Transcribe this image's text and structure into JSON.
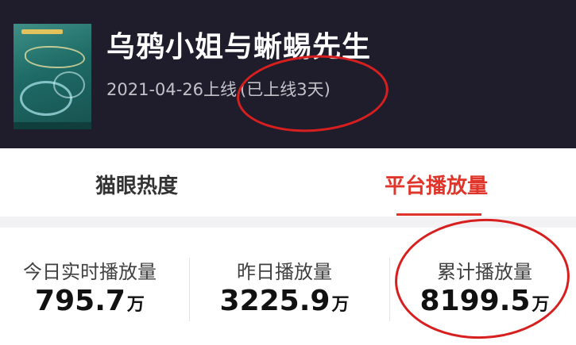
{
  "movie": {
    "title": "乌鸦小姐与蜥蜴先生",
    "release_date_text": "2021-04-26上线",
    "days_online_text": "(已上线3天)"
  },
  "tabs": [
    {
      "label": "猫眼热度",
      "active": false
    },
    {
      "label": "平台播放量",
      "active": true
    }
  ],
  "stats": [
    {
      "label": "今日实时播放量",
      "value": "795.7",
      "unit": "万"
    },
    {
      "label": "昨日播放量",
      "value": "3225.9",
      "unit": "万"
    },
    {
      "label": "累计播放量",
      "value": "8199.5",
      "unit": "万"
    }
  ],
  "colors": {
    "header_bg": "#1f1c2c",
    "accent": "#e0352b",
    "annotation": "#d81f1f"
  }
}
